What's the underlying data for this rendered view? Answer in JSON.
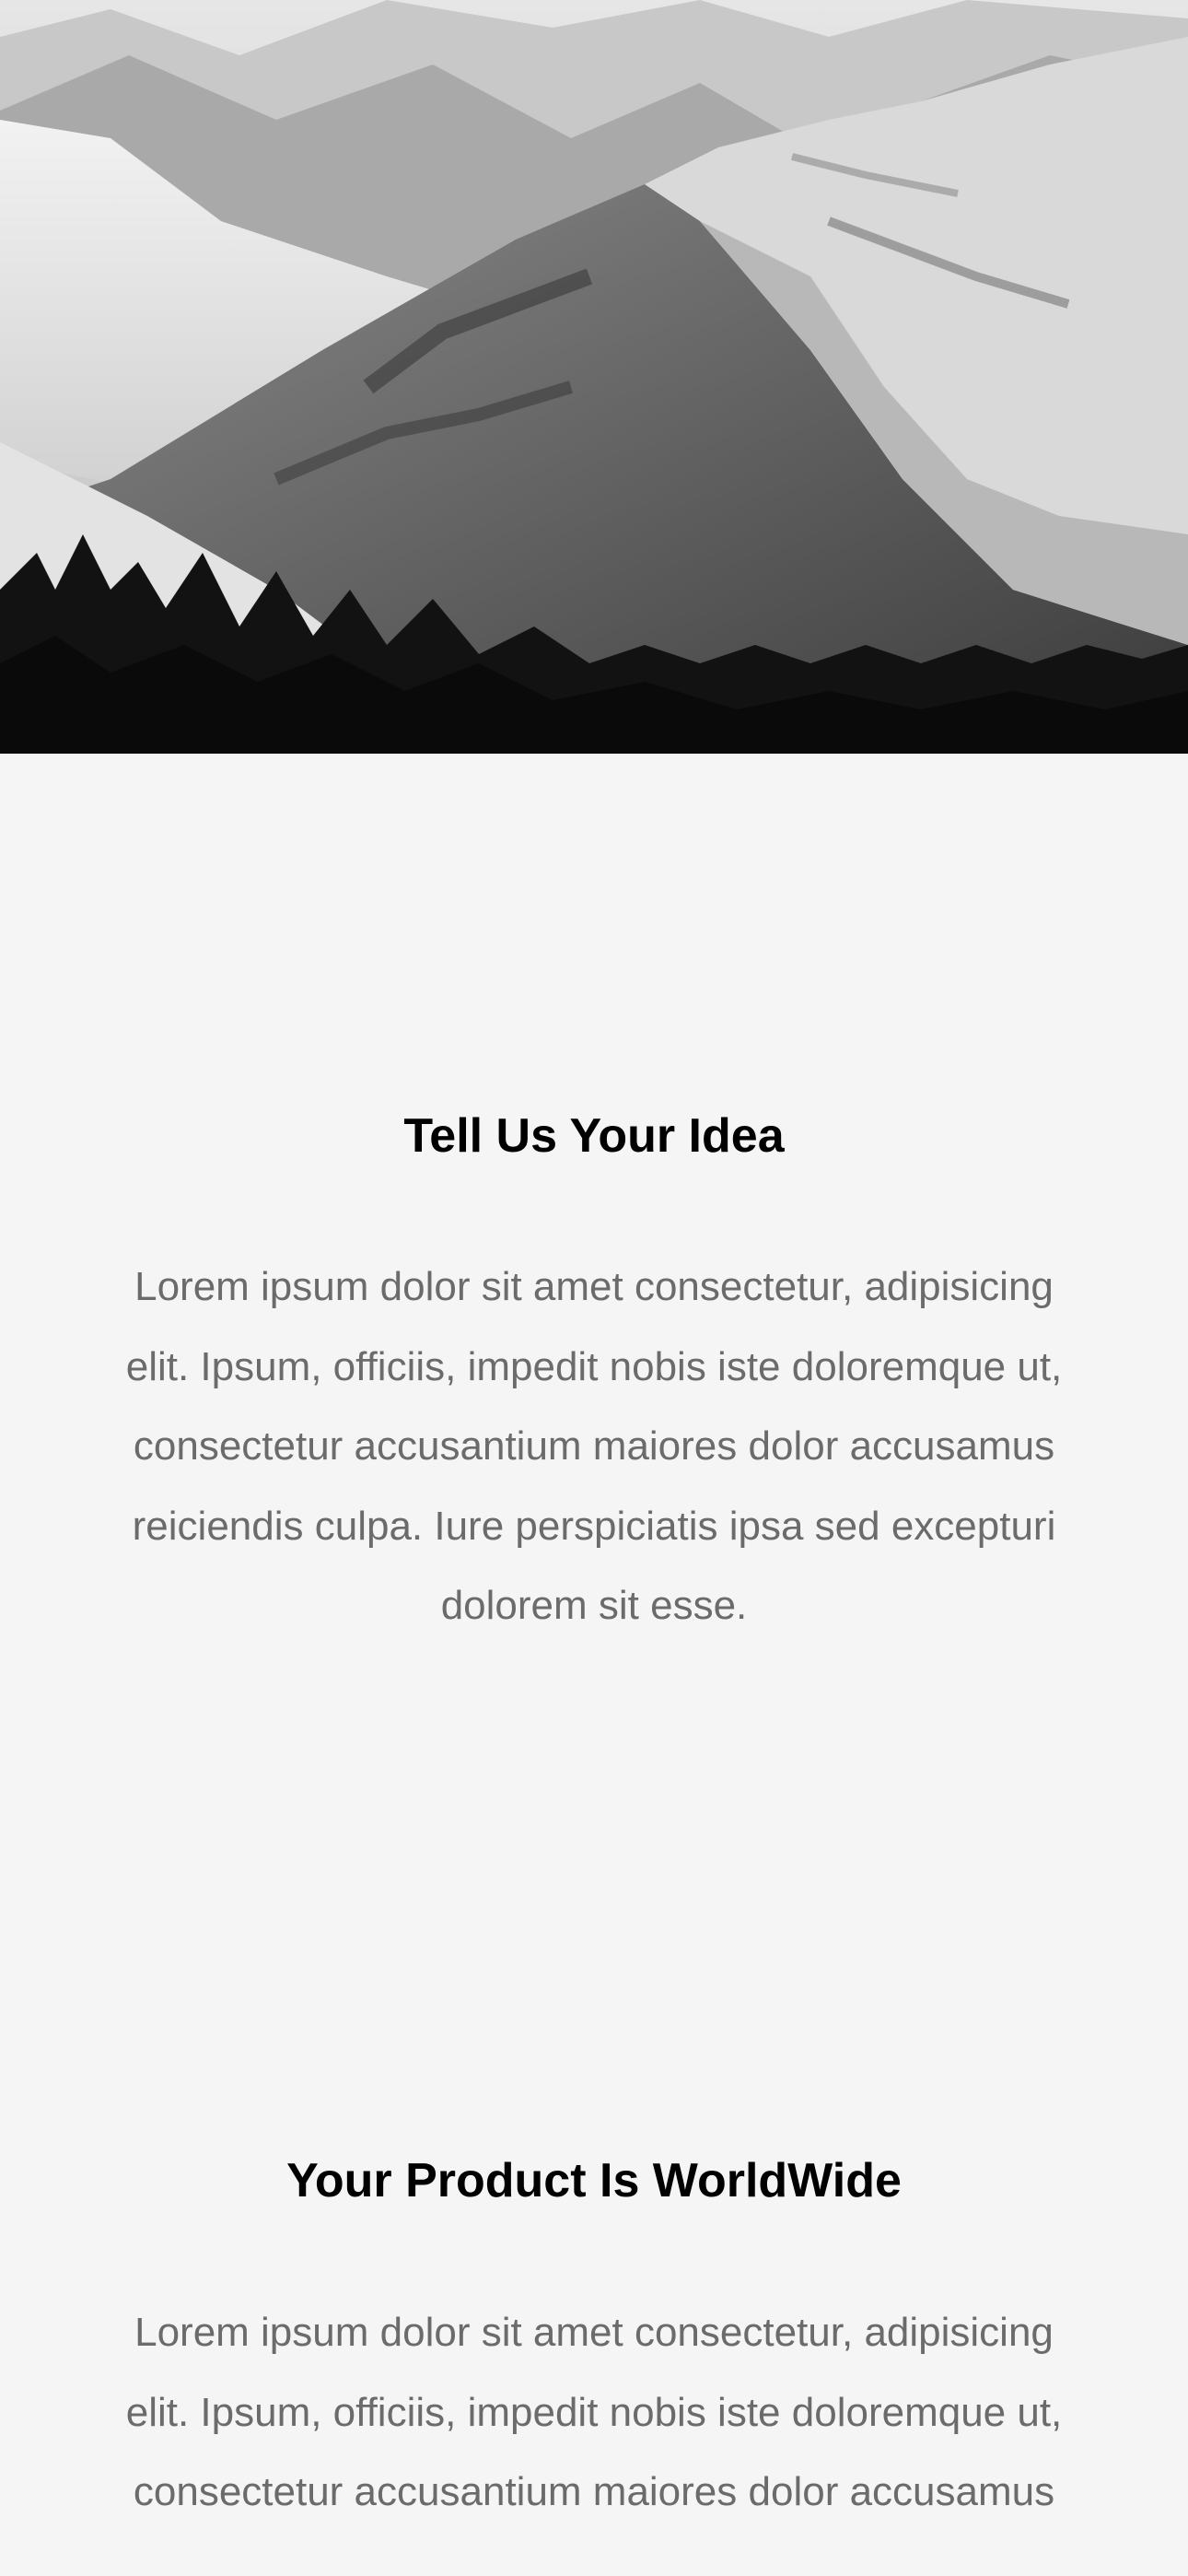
{
  "hero": {
    "image": "snowy-mountains-grayscale"
  },
  "accent_color": "#12c9b1",
  "features": [
    {
      "icon": "diamond-icon",
      "title": "Tell Us Your Idea",
      "text": "Lorem ipsum dolor sit amet consectetur, adipisicing elit. Ipsum, officiis, impedit nobis iste doloremque ut, consectetur accusantium maiores dolor accusamus reiciendis culpa. Iure perspiciatis ipsa sed excepturi dolorem sit esse."
    },
    {
      "icon": "magic-wand-icon",
      "title": "Your Product Is WorldWide",
      "text": "Lorem ipsum dolor sit amet consectetur, adipisicing elit. Ipsum, officiis, impedit nobis iste doloremque ut, consectetur accusantium maiores dolor accusamus"
    }
  ]
}
